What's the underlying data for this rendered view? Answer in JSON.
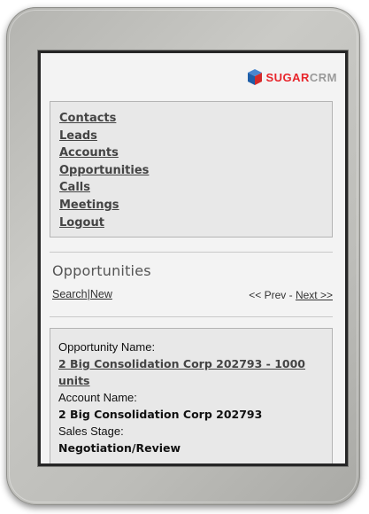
{
  "brand": {
    "name_primary": "SUGAR",
    "name_secondary": "CRM"
  },
  "nav": {
    "items": [
      "Contacts",
      "Leads",
      "Accounts",
      "Opportunities",
      "Calls",
      "Meetings",
      "Logout"
    ]
  },
  "page": {
    "title": "Opportunities"
  },
  "actions": {
    "search": "Search",
    "separator": "|",
    "new": "New"
  },
  "pager": {
    "prev": "<< Prev",
    "separator": "-",
    "next": "Next >>"
  },
  "record": {
    "opportunity_name_label": "Opportunity Name:",
    "opportunity_name": "2 Big Consolidation Corp 202793 - 1000 units",
    "account_name_label": "Account Name:",
    "account_name": "2 Big Consolidation Corp 202793",
    "sales_stage_label": "Sales Stage:",
    "sales_stage": "Negotiation/Review"
  },
  "colors": {
    "brand_red": "#e8252b",
    "brand_gray": "#9a9a9a",
    "cube_blue": "#1e5ea8",
    "cube_red": "#d42a2a"
  }
}
